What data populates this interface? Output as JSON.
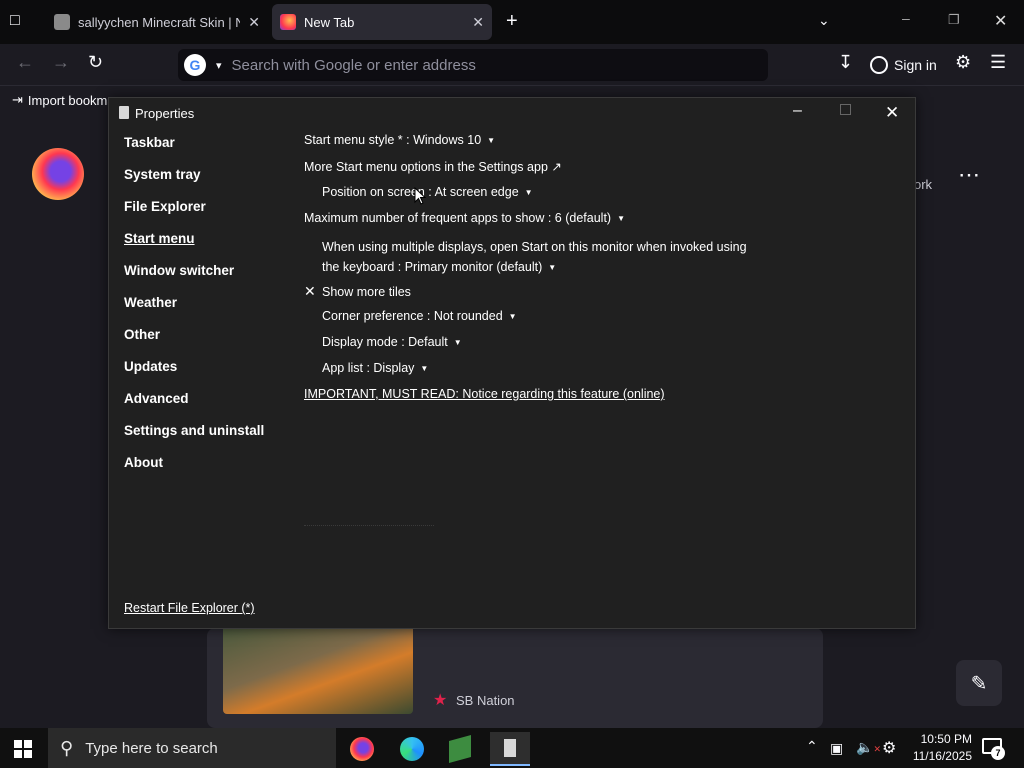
{
  "browser": {
    "tabs": [
      {
        "title": "sallyychen Minecraft Skin | Nam"
      },
      {
        "title": "New Tab"
      }
    ],
    "url_placeholder": "Search with Google or enter address",
    "sign_in": "Sign in",
    "bookmarks_item": "Import bookmarks..."
  },
  "newtab": {
    "shortcut_label_partial": "ork",
    "story_source": "SB Nation"
  },
  "dialog": {
    "title": "Properties",
    "sidebar": [
      "Taskbar",
      "System tray",
      "File Explorer",
      "Start menu",
      "Window switcher",
      "Weather",
      "Other",
      "Updates",
      "Advanced",
      "Settings and uninstall",
      "About"
    ],
    "active_section": "Start menu",
    "restart_link": "Restart File Explorer (*)",
    "settings": {
      "start_style": "Start menu style * : Windows 10",
      "more_options": "More Start menu options in the Settings app ↗",
      "position": "Position on screen : At screen edge",
      "max_frequent": "Maximum number of frequent apps to show : 6 (default)",
      "multi_display_line1": "When using multiple displays, open Start on this monitor when invoked using",
      "multi_display_line2": "the keyboard : Primary monitor (default)",
      "show_more_tiles": "Show more tiles",
      "corner_pref": "Corner preference : Not rounded",
      "display_mode": "Display mode : Default",
      "app_list": "App list : Display",
      "important": "IMPORTANT, MUST READ: Notice regarding this feature (online)"
    }
  },
  "taskbar": {
    "search_placeholder": "Type here to search",
    "time": "10:50 PM",
    "date": "11/16/2025",
    "notification_count": "7"
  }
}
